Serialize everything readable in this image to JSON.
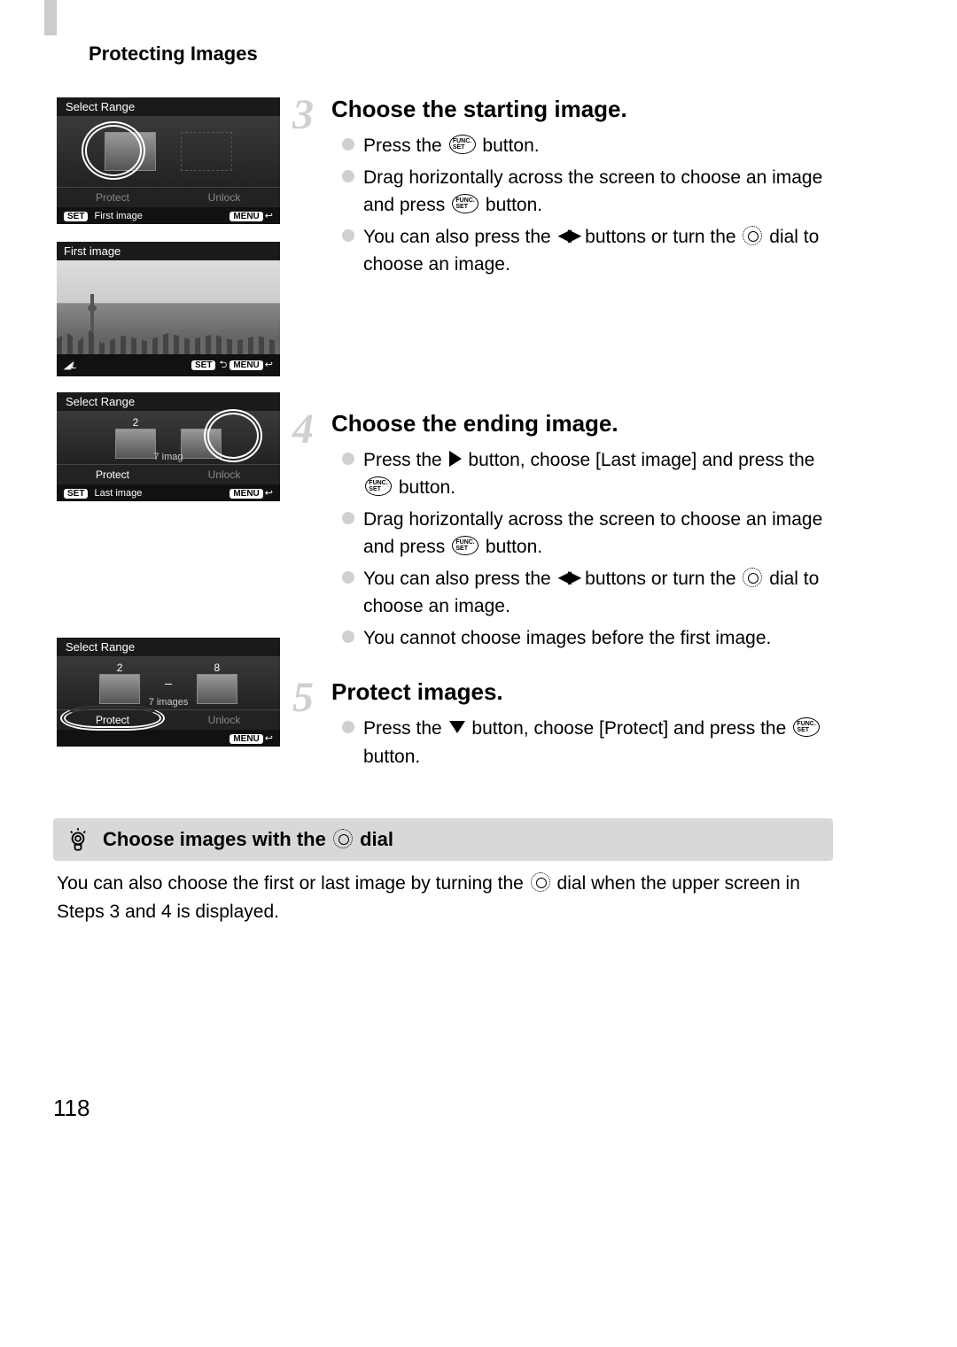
{
  "header": {
    "section_title": "Protecting Images"
  },
  "page_number": "118",
  "screenshots": {
    "s1": {
      "title": "Select Range",
      "action_left": "Protect",
      "action_right": "Unlock",
      "footer_left_badge": "SET",
      "footer_left_text": "First image",
      "footer_right_badge": "MENU"
    },
    "s2": {
      "title": "First image",
      "footer_left": "",
      "footer_mid_badge": "SET",
      "footer_right_badge": "MENU"
    },
    "s3": {
      "title": "Select Range",
      "count_left": "2",
      "mid_text": "7 imag",
      "action_left": "Protect",
      "action_right": "Unlock",
      "footer_left_badge": "SET",
      "footer_left_text": "Last image",
      "footer_right_badge": "MENU"
    },
    "s4": {
      "title": "Select Range",
      "count_left": "2",
      "count_right": "8",
      "mid_text": "7 images",
      "action_left": "Protect",
      "action_right": "Unlock",
      "footer_right_badge": "MENU"
    }
  },
  "steps": {
    "step3": {
      "num": "3",
      "title": "Choose the starting image.",
      "b1_a": "Press the ",
      "b1_b": " button.",
      "b2_a": "Drag horizontally across the screen to choose an image and press ",
      "b2_b": " button.",
      "b3_a": "You can also press the ",
      "b3_b": " buttons or turn the ",
      "b3_c": " dial to choose an image."
    },
    "step4": {
      "num": "4",
      "title": "Choose the ending image.",
      "b1_a": "Press the ",
      "b1_b": " button, choose [Last image] and press the ",
      "b1_c": " button.",
      "b2_a": "Drag horizontally across the screen to choose an image and press ",
      "b2_b": " button.",
      "b3_a": "You can also press the ",
      "b3_b": " buttons or turn the ",
      "b3_c": " dial to choose an image.",
      "b4": "You cannot choose images before the first image."
    },
    "step5": {
      "num": "5",
      "title": "Protect images.",
      "b1_a": "Press the ",
      "b1_b": " button, choose [Protect] and press the ",
      "b1_c": " button."
    }
  },
  "tip": {
    "title_a": "Choose images with the ",
    "title_b": " dial",
    "body_a": "You can also choose the first or last image by turning the ",
    "body_b": " dial when the upper screen in Steps 3 and 4 is displayed."
  }
}
